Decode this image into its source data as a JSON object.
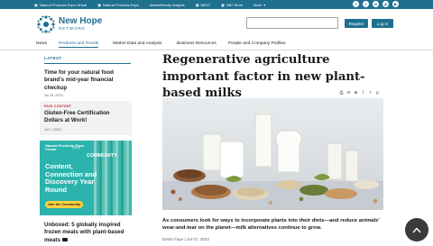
{
  "topbar": {
    "links": [
      {
        "label": "Natural Products Expo Virtual",
        "icon": "expo-icon"
      },
      {
        "label": "Natural Products Expo",
        "icon": "expo-icon"
      },
      {
        "label": "MarketReady Insights",
        "icon": "insights-icon"
      },
      {
        "label": "NEXT",
        "icon": "next-icon"
      },
      {
        "label": "NBJ Store",
        "icon": "store-icon"
      },
      {
        "label": "More",
        "icon": "chevron-down-icon"
      }
    ],
    "social": [
      "facebook-icon",
      "twitter-icon",
      "linkedin-icon",
      "instagram-icon",
      "youtube-icon"
    ]
  },
  "header": {
    "logo_line1": "New Hope",
    "logo_line2": "NETWORK",
    "register_label": "Register",
    "login_label": "Log In",
    "search_placeholder": ""
  },
  "nav": {
    "items": [
      "News",
      "Products and Trends",
      "Market Data and Analysis",
      "Business Resources",
      "People and Company Profiles"
    ],
    "active": "Products and Trends"
  },
  "sidebar": {
    "section_label": "LATEST",
    "articles": [
      {
        "title": "Time for your natural food brand's mid-year financial checkup",
        "date": "Jul 18, 2022"
      }
    ],
    "paid": {
      "tag": "PAID CONTENT",
      "title": "Gluten-Free Certification Dollars at Work!",
      "date": "Jul 1, 2022"
    },
    "ad": {
      "brand": "Natural Products Expo",
      "brand_sub": "Virtual",
      "year": "2022",
      "community": "COMMUNITY",
      "headline": "Content, Connection and Discovery Year Round",
      "cta": "Join the Community"
    },
    "bottom_article": {
      "title": "Unboxed: 5 globally inspired frozen meals with plant-based meats"
    }
  },
  "article": {
    "headline": "Regenerative agriculture important factor in new plant-based milks",
    "lede": "As consumers look for ways to incorporate plants into their diets—and reduce animals' wear-and-tear on the planet—milk alternatives continue to grow.",
    "author": "Denis Faye",
    "date": "Jul 07, 2022",
    "tools": [
      "print-icon",
      "email-icon",
      "share-icon",
      "facebook-icon",
      "twitter-icon",
      "pinterest-icon"
    ]
  },
  "colors": {
    "brand": "#1f6f8f",
    "accent_red": "#c4262e",
    "ad_teal": "#2bb3ad",
    "cta_yellow": "#ffd23f"
  }
}
